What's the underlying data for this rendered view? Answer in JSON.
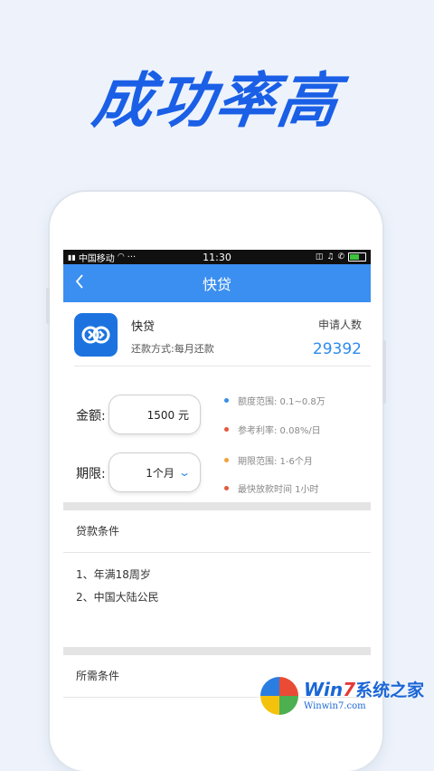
{
  "hero": {
    "title": "成功率高"
  },
  "status_bar": {
    "carrier": "中国移动",
    "dots": "···",
    "time": "11:30"
  },
  "nav": {
    "back_icon": "chevron-left-icon",
    "title": "快贷"
  },
  "loan": {
    "name": "快贷",
    "repay_method": "还款方式:每月还款",
    "applicants_label": "申请人数",
    "applicants_count": "29392"
  },
  "form": {
    "amount_label": "金额:",
    "amount_value": "1500 元",
    "term_label": "期限:",
    "term_value": "1个月",
    "info": [
      {
        "text": "额度范围: 0.1~0.8万",
        "color": "#3a8ee6"
      },
      {
        "text": "参考利率: 0.08%/日",
        "color": "#e45a3c"
      },
      {
        "text": "期限范围: 1-6个月",
        "color": "#f0a23a"
      },
      {
        "text": "最快放款时间 1小时",
        "color": "#e45a3c"
      }
    ]
  },
  "loan_conditions": {
    "title": "贷款条件",
    "items": [
      "1、年满18周岁",
      "2、中国大陆公民"
    ]
  },
  "required": {
    "title": "所需条件"
  },
  "colors": {
    "primary": "#3b8ff0",
    "accent_text": "#2c8cef",
    "hero": "#1a5fe6"
  },
  "watermark": {
    "brand_a": "Win",
    "brand_seven": "7",
    "brand_cn": "系统之家",
    "url": "Winwin7.com"
  }
}
